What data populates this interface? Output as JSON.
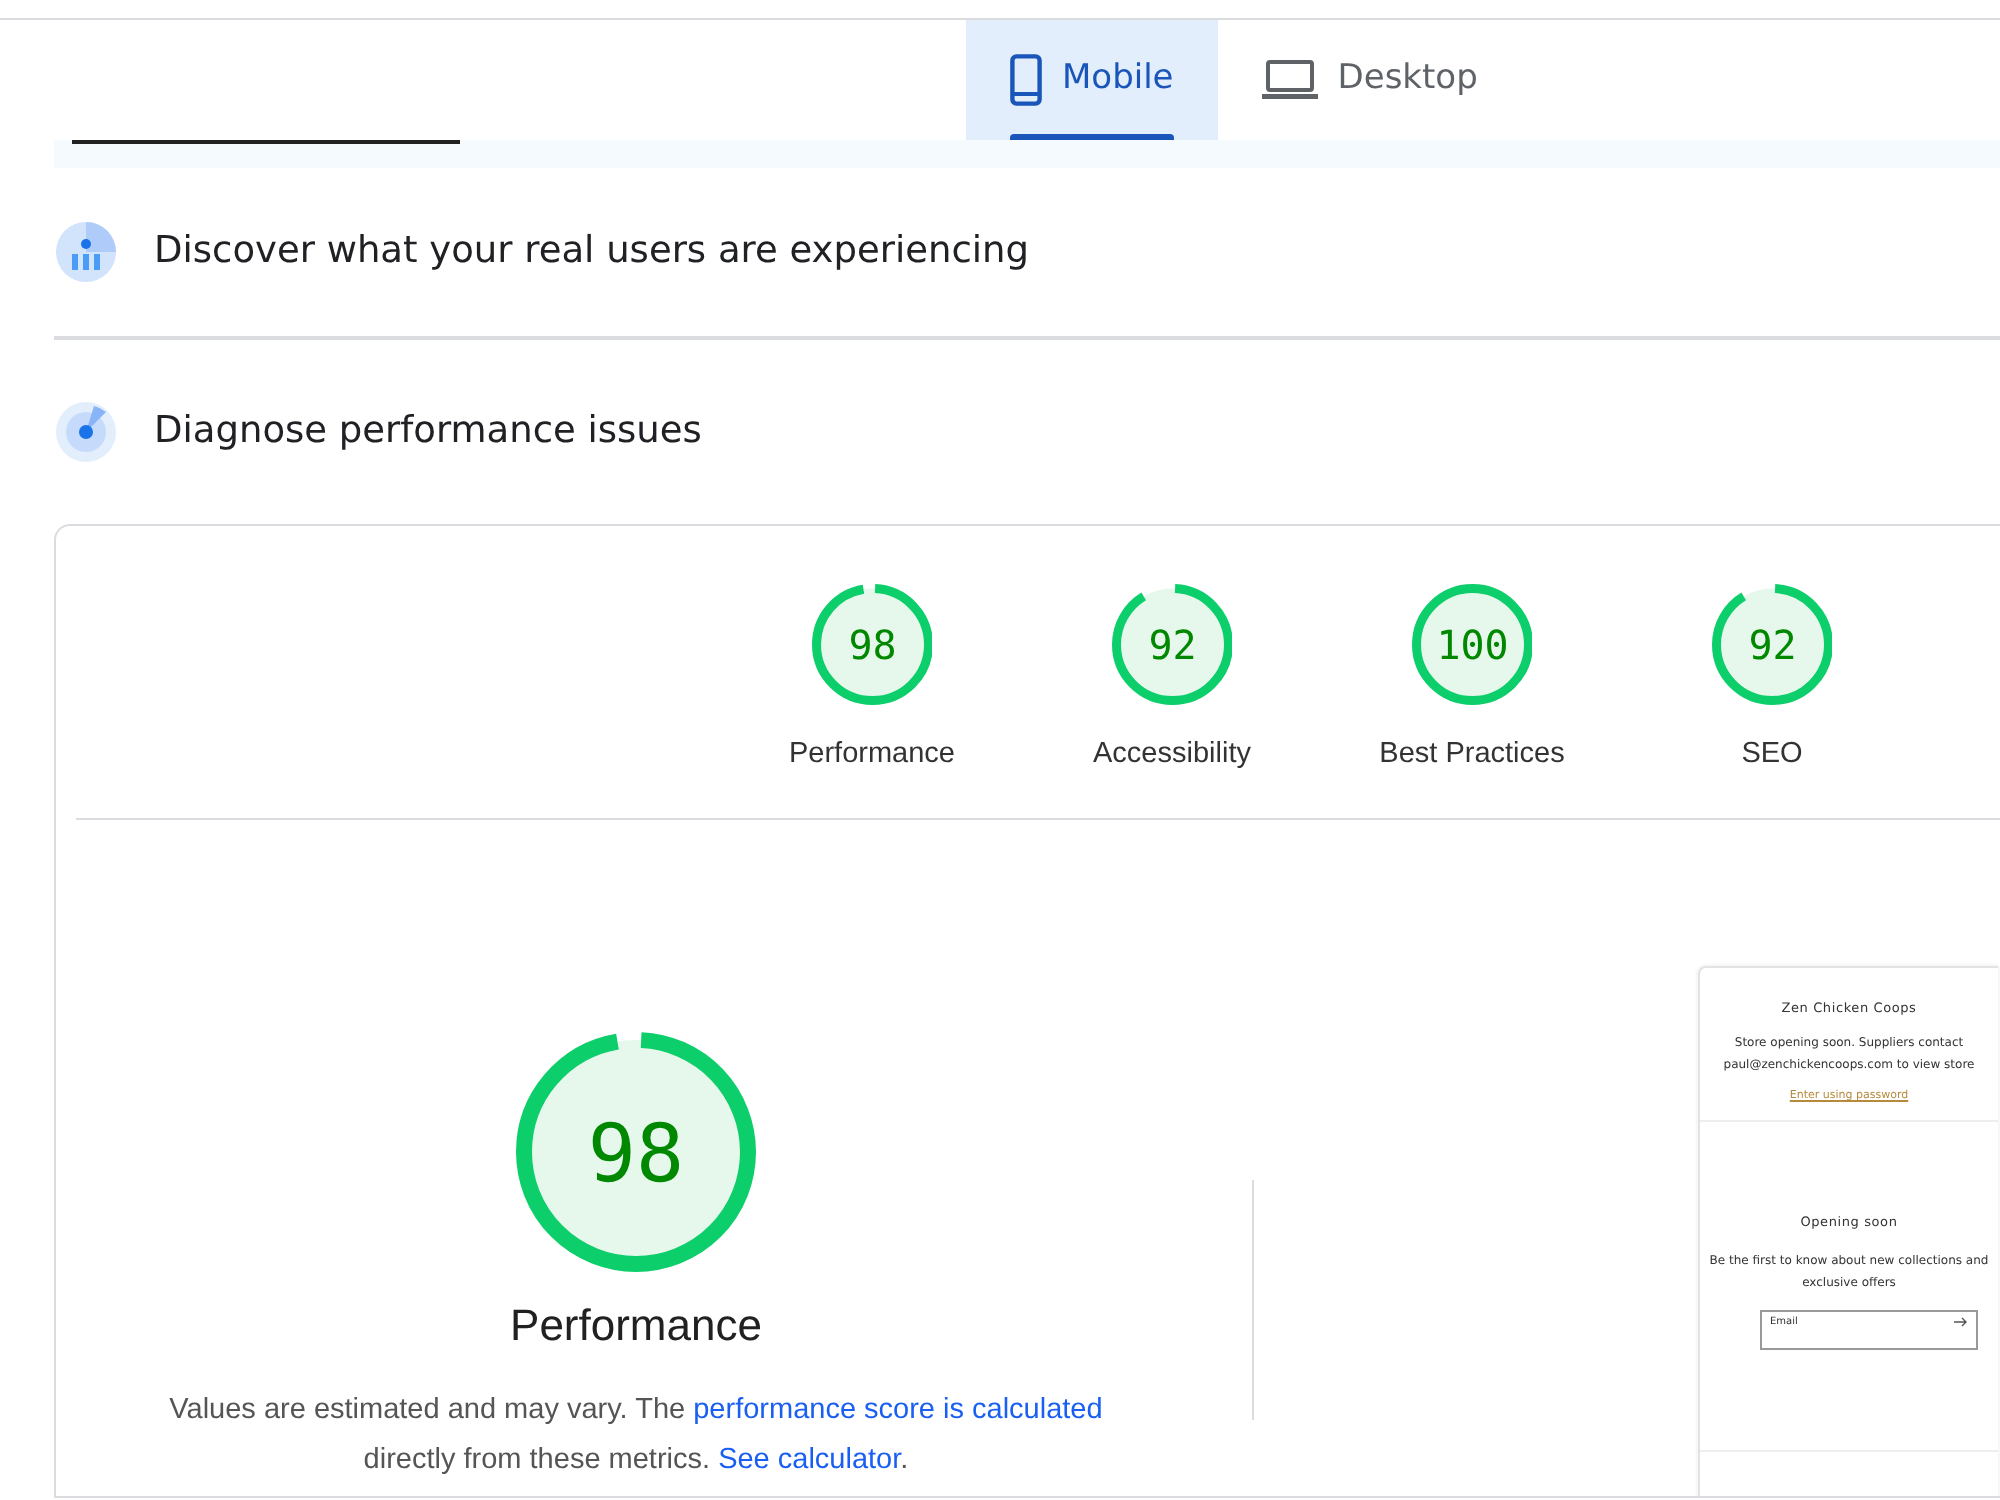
{
  "device_tabs": [
    {
      "label": "Mobile",
      "kind": "phone",
      "selected": true
    },
    {
      "label": "Desktop",
      "kind": "laptop",
      "selected": false
    }
  ],
  "sections": [
    {
      "kind": "users",
      "title": "Discover what your real users are experiencing"
    },
    {
      "kind": "diagnose",
      "title": "Diagnose performance issues"
    }
  ],
  "score_gauges": [
    {
      "score": "98",
      "label": "Performance",
      "level": 0.98
    },
    {
      "score": "92",
      "label": "Accessibility",
      "level": 0.92
    },
    {
      "score": "100",
      "label": "Best Practices",
      "level": 1
    },
    {
      "score": "92",
      "label": "SEO",
      "level": 0.92
    }
  ],
  "performance": {
    "score": "98",
    "level": 0.98,
    "title": "Performance",
    "note": "Values are estimated and may vary. The ",
    "link1": "performance score is calculated",
    "note2": " directly from these metrics. ",
    "link2": "See calculator",
    "note3": "."
  },
  "preview": {
    "store_name": "Zen Chicken Coops",
    "message": "Store opening soon. Suppliers contact paul@zenchickencoops.com to view store",
    "password_link": "Enter using password",
    "heading": "Opening soon",
    "subtext": "Be the first to know about new collections and exclusive offers",
    "email_placeholder": "Email"
  }
}
